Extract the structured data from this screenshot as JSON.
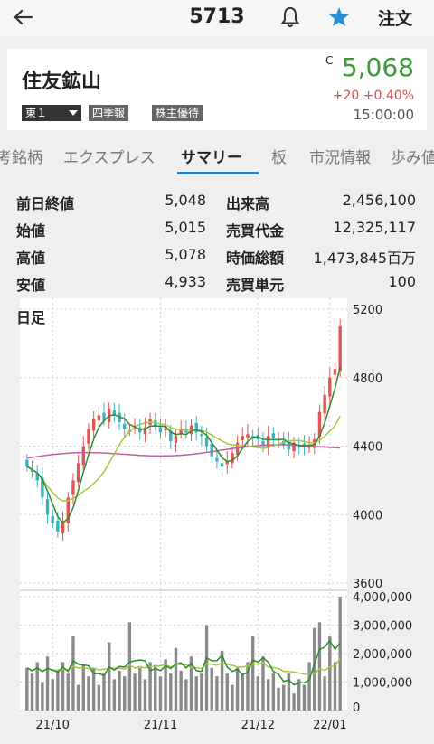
{
  "header": {
    "code": "5713",
    "order_label": "注文",
    "icons": {
      "back": "back-arrow-icon",
      "bell": "bell-icon",
      "star": "star-icon"
    },
    "star_color": "#2a8fd0"
  },
  "stock": {
    "name": "住友鉱山",
    "market": "東１",
    "tag_quarterly": "四季報",
    "tag_yutai": "株主優待",
    "c_mark": "C",
    "price": "5,068",
    "change": "+20  +0.40%",
    "time": "15:00:00",
    "price_color": "#3a9a3a",
    "change_color": "#d05050"
  },
  "tabs": [
    "考銘柄",
    "エクスプレス",
    "サマリー",
    "板",
    "市況情報",
    "歩み値"
  ],
  "active_tab": "サマリー",
  "stats": [
    {
      "label1": "前日終値",
      "value1": "5,048",
      "label2": "出来高",
      "value2": "2,456,100"
    },
    {
      "label1": "始値",
      "value1": "5,015",
      "label2": "売買代金",
      "value2": "12,325,117"
    },
    {
      "label1": "高値",
      "value1": "5,078",
      "label2": "時価総額",
      "value2": "1,473,845百万"
    },
    {
      "label1": "安値",
      "value1": "4,933",
      "label2": "売買単元",
      "value2": "100"
    }
  ],
  "chart_data": {
    "type": "candlestick",
    "label": "日足",
    "price_axis": [
      5200,
      4800,
      4400,
      4000,
      3600
    ],
    "volume_axis": [
      "4,000,000",
      "3,000,000",
      "2,000,000",
      "1,000,000",
      "0"
    ],
    "x_labels": [
      "21/10",
      "21/11",
      "21/12",
      "22/01"
    ],
    "price_ylim": [
      3600,
      5200
    ],
    "volume_ylim": [
      0,
      4000000
    ],
    "up_color": "#e05555",
    "down_color": "#3ab3c0",
    "ma_colors": {
      "short": "#2e8a2e",
      "mid": "#a8c83c",
      "long": "#c060a0"
    },
    "volume_ma_colors": {
      "short": "#2e8a2e",
      "long": "#a8c83c"
    },
    "closes": [
      4280,
      4250,
      4200,
      4100,
      4000,
      3950,
      3900,
      3960,
      4100,
      4200,
      4300,
      4400,
      4500,
      4560,
      4580,
      4550,
      4620,
      4580,
      4540,
      4500,
      4490,
      4520,
      4480,
      4510,
      4560,
      4520,
      4480,
      4500,
      4430,
      4460,
      4500,
      4480,
      4520,
      4480,
      4460,
      4400,
      4340,
      4310,
      4280,
      4310,
      4360,
      4420,
      4460,
      4470,
      4450,
      4440,
      4400,
      4460,
      4450,
      4440,
      4410,
      4380,
      4420,
      4400,
      4400,
      4400,
      4440,
      4600,
      4700,
      4800,
      4850,
      5100
    ],
    "volumes": [
      1500000,
      1300000,
      1700000,
      1000000,
      1900000,
      1100000,
      1400000,
      1700000,
      1300000,
      2600000,
      900000,
      1600000,
      1200000,
      1500000,
      900000,
      1300000,
      2400000,
      1100000,
      1400000,
      1200000,
      3100000,
      1300000,
      1500000,
      1100000,
      1700000,
      1600000,
      1200000,
      1800000,
      1300000,
      2200000,
      1400000,
      1100000,
      1900000,
      1200000,
      1300000,
      3000000,
      1500000,
      1200000,
      2100000,
      1300000,
      900000,
      1500000,
      1300000,
      1700000,
      2600000,
      1200000,
      1900000,
      1100000,
      1300000,
      800000,
      900000,
      1300000,
      600000,
      1100000,
      900000,
      1700000,
      2900000,
      3100000,
      1200000,
      2600000,
      1700000,
      4000000
    ]
  }
}
